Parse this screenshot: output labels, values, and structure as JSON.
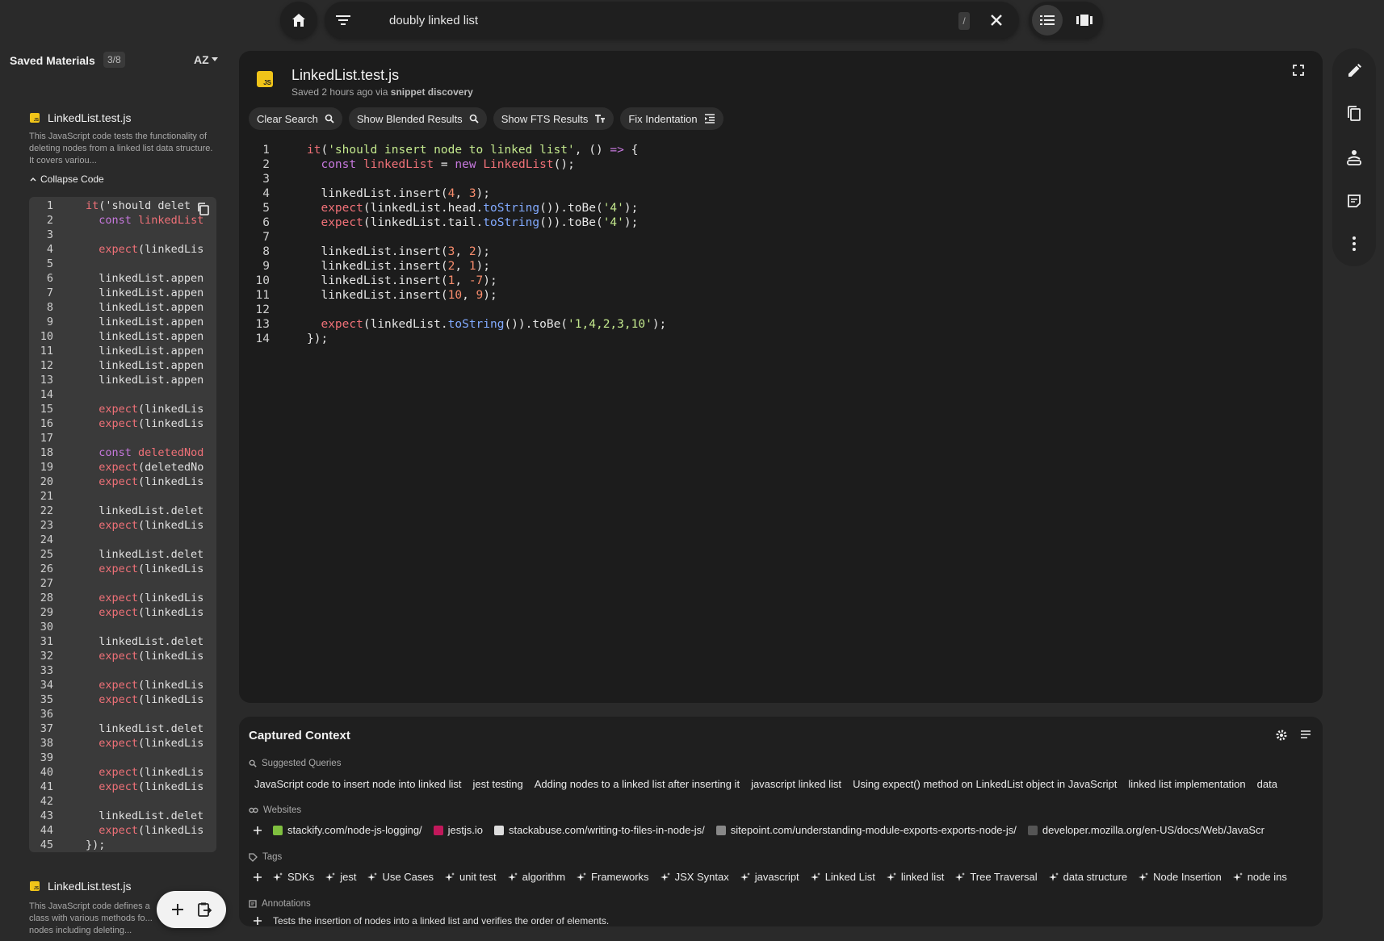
{
  "search": {
    "query": "doubly linked list",
    "shortcut_key": "/"
  },
  "sidebar": {
    "title": "Saved Materials",
    "count": "3/8",
    "sort_label": "AZ",
    "items": [
      {
        "title": "LinkedList.test.js",
        "description": "This JavaScript code tests the functionality of deleting nodes from a linked list data structure. It covers variou...",
        "collapse_label": "Collapse Code"
      },
      {
        "title": "LinkedList.test.js",
        "description": "This JavaScript code defines a class with various methods fo... nodes including deleting..."
      }
    ],
    "mini_code": {
      "line_numbers": [
        "1",
        "2",
        "3",
        "4",
        "5",
        "6",
        "7",
        "8",
        "9",
        "10",
        "11",
        "12",
        "13",
        "14",
        "15",
        "16",
        "17",
        "18",
        "19",
        "20",
        "21",
        "22",
        "23",
        "24",
        "25",
        "26",
        "27",
        "28",
        "29",
        "30",
        "31",
        "32",
        "33",
        "34",
        "35",
        "36",
        "37",
        "38",
        "39",
        "40",
        "41",
        "42",
        "43",
        "44",
        "45"
      ],
      "lines": [
        "it('should delet",
        "  const linkedList",
        "",
        "  expect(linkedLis",
        "",
        "  linkedList.appen",
        "  linkedList.appen",
        "  linkedList.appen",
        "  linkedList.appen",
        "  linkedList.appen",
        "  linkedList.appen",
        "  linkedList.appen",
        "  linkedList.appen",
        "",
        "  expect(linkedLis",
        "  expect(linkedLis",
        "",
        "  const deletedNod",
        "  expect(deletedNo",
        "  expect(linkedLis",
        "",
        "  linkedList.delet",
        "  expect(linkedLis",
        "",
        "  linkedList.delet",
        "  expect(linkedLis",
        "",
        "  expect(linkedLis",
        "  expect(linkedLis",
        "",
        "  linkedList.delet",
        "  expect(linkedLis",
        "",
        "  expect(linkedLis",
        "  expect(linkedLis",
        "",
        "  linkedList.delet",
        "  expect(linkedLis",
        "",
        "  expect(linkedLis",
        "  expect(linkedLis",
        "",
        "  linkedList.delet",
        "  expect(linkedLis",
        "});"
      ]
    }
  },
  "main": {
    "title": "LinkedList.test.js",
    "saved_prefix": "Saved 2 hours ago via",
    "saved_source": "snippet discovery",
    "chips": [
      "Clear Search",
      "Show Blended Results",
      "Show FTS Results",
      "Fix Indentation"
    ],
    "code": {
      "line_numbers": [
        "1",
        "2",
        "3",
        "4",
        "5",
        "6",
        "7",
        "8",
        "9",
        "10",
        "11",
        "12",
        "13",
        "14"
      ],
      "lines": [
        "it('should insert node to linked list', () => {",
        "  const linkedList = new LinkedList();",
        "",
        "  linkedList.insert(4, 3);",
        "  expect(linkedList.head.toString()).toBe('4');",
        "  expect(linkedList.tail.toString()).toBe('4');",
        "",
        "  linkedList.insert(3, 2);",
        "  linkedList.insert(2, 1);",
        "  linkedList.insert(1, -7);",
        "  linkedList.insert(10, 9);",
        "",
        "  expect(linkedList.toString()).toBe('1,4,2,3,10');",
        "});"
      ]
    }
  },
  "context": {
    "title": "Captured Context",
    "suggested_label": "Suggested Queries",
    "queries": [
      "JavaScript code to insert node into linked list",
      "jest testing",
      "Adding nodes to a linked list after inserting it",
      "javascript linked list",
      "Using expect() method on LinkedList object in JavaScript",
      "linked list implementation",
      "data"
    ],
    "websites_label": "Websites",
    "websites": [
      {
        "url": "stackify.com/node-js-logging/",
        "color": "#7fbf3f"
      },
      {
        "url": "jestjs.io",
        "color": "#c2185b"
      },
      {
        "url": "stackabuse.com/writing-to-files-in-node-js/",
        "color": "#dddddd"
      },
      {
        "url": "sitepoint.com/understanding-module-exports-exports-node-js/",
        "color": "#888888"
      },
      {
        "url": "developer.mozilla.org/en-US/docs/Web/JavaScr",
        "color": "#555555"
      }
    ],
    "tags_label": "Tags",
    "tags": [
      "SDKs",
      "jest",
      "Use Cases",
      "unit test",
      "algorithm",
      "Frameworks",
      "JSX Syntax",
      "javascript",
      "Linked List",
      "linked list",
      "Tree Traversal",
      "data structure",
      "Node Insertion",
      "node ins"
    ],
    "annotations_label": "Annotations",
    "annotation": "Tests the insertion of nodes into a linked list and verifies the order of elements."
  }
}
